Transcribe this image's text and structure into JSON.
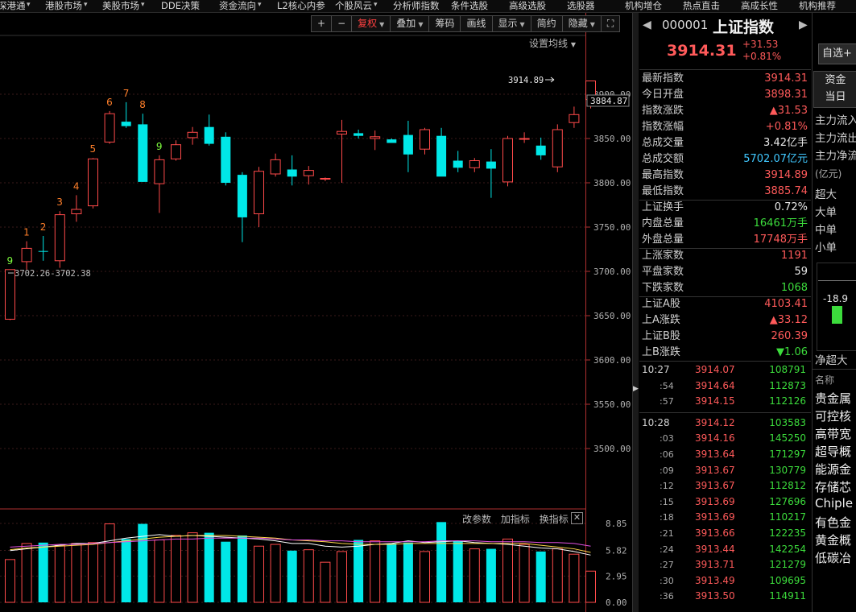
{
  "topbar": {
    "items": [
      {
        "label": "深港通",
        "arrow": true
      },
      {
        "label": "港股市场",
        "arrow": true
      },
      {
        "label": "美股市场",
        "arrow": true
      },
      {
        "label": "DDE决策",
        "arrow": false
      },
      {
        "label": "资金流向",
        "arrow": true
      },
      {
        "label": "L2核心内参",
        "arrow": false
      },
      {
        "label": "个股风云",
        "arrow": true
      },
      {
        "label": "分析师指数",
        "arrow": false
      },
      {
        "label": "条件选股",
        "arrow": false
      },
      {
        "label": "高级选股",
        "arrow": false
      },
      {
        "label": "选股器",
        "arrow": false
      },
      {
        "label": "机构增仓",
        "arrow": false
      },
      {
        "label": "热点直击",
        "arrow": false
      },
      {
        "label": "高成长性",
        "arrow": false
      },
      {
        "label": "机构推荐",
        "arrow": false
      }
    ]
  },
  "toolbar": {
    "plus": "+",
    "minus": "−",
    "fuquan": "复权",
    "overlay": "叠加",
    "chips": "筹码",
    "draw": "画线",
    "display": "显示",
    "simple": "简约",
    "hide": "隐藏",
    "fullscreen": "⛶"
  },
  "chart": {
    "ma_settings": "设置均线",
    "max_label": "3914.89",
    "last_price_tag": "3884.87",
    "range_label": "3702.26-3702.38",
    "y_ticks": [
      "3900.00",
      "3850.00",
      "3800.00",
      "3750.00",
      "3700.00",
      "3650.00",
      "3600.00",
      "3550.00",
      "3500.00"
    ],
    "vol_ticks": [
      "8.85",
      "5.82",
      "2.95",
      "0.00"
    ],
    "vol_links": {
      "params": "改参数",
      "add": "加指标",
      "switch": "换指标",
      "close": "✕"
    },
    "seq_colors": {
      "red": "#ff7f2a",
      "green": "#7fff3f"
    }
  },
  "chart_data": {
    "type": "candlestick",
    "ylim": [
      3460,
      3935
    ],
    "vol_ylim": [
      0,
      8.85
    ],
    "candles": [
      {
        "o": 3646,
        "h": 3702,
        "l": 3645,
        "c": 3702,
        "up": true,
        "vol": 4.8,
        "seq": "9",
        "seqc": "green"
      },
      {
        "o": 3711,
        "h": 3734,
        "l": 3702,
        "c": 3726,
        "up": true,
        "vol": 6.6,
        "seq": "1",
        "seqc": "red"
      },
      {
        "o": 3723,
        "h": 3740,
        "l": 3712,
        "c": 3723,
        "up": false,
        "vol": 6.7,
        "seq": "2",
        "seqc": "red"
      },
      {
        "o": 3712,
        "h": 3768,
        "l": 3704,
        "c": 3764,
        "up": true,
        "vol": 6.4,
        "seq": "3",
        "seqc": "red"
      },
      {
        "o": 3765,
        "h": 3786,
        "l": 3756,
        "c": 3770,
        "up": true,
        "vol": 6.6,
        "seq": "4",
        "seqc": "red"
      },
      {
        "o": 3774,
        "h": 3828,
        "l": 3771,
        "c": 3827,
        "up": true,
        "vol": 6.7,
        "seq": "5",
        "seqc": "red"
      },
      {
        "o": 3846,
        "h": 3881,
        "l": 3844,
        "c": 3878,
        "up": true,
        "vol": 8.8,
        "seq": "6",
        "seqc": "red"
      },
      {
        "o": 3864,
        "h": 3891,
        "l": 3862,
        "c": 3869,
        "up": false,
        "vol": 7.1,
        "seq": "7",
        "seqc": "red"
      },
      {
        "o": 3866,
        "h": 3878,
        "l": 3801,
        "c": 3801,
        "up": false,
        "vol": 8.8,
        "seq": "8",
        "seqc": "red"
      },
      {
        "o": 3799,
        "h": 3831,
        "l": 3766,
        "c": 3826,
        "up": true,
        "vol": 7.0,
        "seq": "9",
        "seqc": "green"
      },
      {
        "o": 3827,
        "h": 3848,
        "l": 3825,
        "c": 3843,
        "up": true,
        "vol": 7.5
      },
      {
        "o": 3851,
        "h": 3863,
        "l": 3843,
        "c": 3857,
        "up": true,
        "vol": 7.8
      },
      {
        "o": 3863,
        "h": 3877,
        "l": 3842,
        "c": 3844,
        "up": false,
        "vol": 7.8
      },
      {
        "o": 3852,
        "h": 3857,
        "l": 3797,
        "c": 3800,
        "up": false,
        "vol": 6.8
      },
      {
        "o": 3809,
        "h": 3812,
        "l": 3733,
        "c": 3761,
        "up": false,
        "vol": 7.5
      },
      {
        "o": 3765,
        "h": 3818,
        "l": 3750,
        "c": 3813,
        "up": true,
        "vol": 6.3
      },
      {
        "o": 3810,
        "h": 3833,
        "l": 3807,
        "c": 3826,
        "up": true,
        "vol": 6.5
      },
      {
        "o": 3815,
        "h": 3831,
        "l": 3797,
        "c": 3807,
        "up": false,
        "vol": 5.8
      },
      {
        "o": 3808,
        "h": 3819,
        "l": 3798,
        "c": 3814,
        "up": true,
        "vol": 5.9
      },
      {
        "o": 3805,
        "h": 3806,
        "l": 3802,
        "c": 3805,
        "up": true,
        "vol": 4.5
      },
      {
        "o": 3855,
        "h": 3871,
        "l": 3800,
        "c": 3858,
        "up": true,
        "vol": 5.7
      },
      {
        "o": 3853,
        "h": 3860,
        "l": 3850,
        "c": 3856,
        "up": false,
        "vol": 7.0
      },
      {
        "o": 3850,
        "h": 3859,
        "l": 3837,
        "c": 3852,
        "up": true,
        "vol": 6.9
      },
      {
        "o": 3849,
        "h": 3850,
        "l": 3845,
        "c": 3845,
        "up": false,
        "vol": 6.6
      },
      {
        "o": 3854,
        "h": 3870,
        "l": 3812,
        "c": 3832,
        "up": false,
        "vol": 6.7
      },
      {
        "o": 3838,
        "h": 3862,
        "l": 3832,
        "c": 3860,
        "up": true,
        "vol": 5.7
      },
      {
        "o": 3853,
        "h": 3862,
        "l": 3810,
        "c": 3807,
        "up": false,
        "vol": 9.0
      },
      {
        "o": 3825,
        "h": 3836,
        "l": 3812,
        "c": 3817,
        "up": false,
        "vol": 6.9
      },
      {
        "o": 3817,
        "h": 3828,
        "l": 3812,
        "c": 3825,
        "up": true,
        "vol": 6.0
      },
      {
        "o": 3824,
        "h": 3838,
        "l": 3783,
        "c": 3816,
        "up": false,
        "vol": 6.0
      },
      {
        "o": 3801,
        "h": 3853,
        "l": 3796,
        "c": 3850,
        "up": true,
        "vol": 7.1
      },
      {
        "o": 3850,
        "h": 3857,
        "l": 3845,
        "c": 3850,
        "up": true,
        "vol": 6.5
      },
      {
        "o": 3831,
        "h": 3851,
        "l": 3826,
        "c": 3842,
        "up": false,
        "vol": 5.7
      },
      {
        "o": 3818,
        "h": 3866,
        "l": 3812,
        "c": 3860,
        "up": true,
        "vol": 6.0
      },
      {
        "o": 3868,
        "h": 3886,
        "l": 3862,
        "c": 3877,
        "up": true,
        "vol": 5.4
      },
      {
        "o": 3894,
        "h": 3915,
        "l": 3884,
        "c": 3915,
        "up": true,
        "vol": 3.5
      }
    ],
    "ma_lines": [
      {
        "name": "MA5",
        "color": "#ffffff",
        "values": [
          5.8,
          6.0,
          6.2,
          6.4,
          6.6,
          6.6,
          6.9,
          7.2,
          7.4,
          7.6,
          7.4,
          7.5,
          7.4,
          7.3,
          7.2,
          7.1,
          6.9,
          6.6,
          6.6,
          6.3,
          6.2,
          6.3,
          6.5,
          6.6,
          6.9,
          6.7,
          6.8,
          6.9,
          6.7,
          6.6,
          6.5,
          6.3,
          6.1,
          6.0,
          5.7,
          5.3
        ]
      },
      {
        "name": "MA10",
        "color": "#ffd84a",
        "values": [
          5.9,
          6.1,
          6.2,
          6.3,
          6.4,
          6.5,
          6.7,
          6.9,
          7.1,
          7.3,
          7.4,
          7.5,
          7.5,
          7.5,
          7.4,
          7.3,
          7.2,
          7.0,
          6.9,
          6.8,
          6.6,
          6.5,
          6.5,
          6.5,
          6.6,
          6.6,
          6.6,
          6.6,
          6.6,
          6.6,
          6.6,
          6.6,
          6.4,
          6.2,
          6.0,
          5.6
        ]
      },
      {
        "name": "MA20",
        "color": "#e050e0",
        "values": [
          6.2,
          6.3,
          6.4,
          6.5,
          6.5,
          6.6,
          6.7,
          6.8,
          6.9,
          7.0,
          7.1,
          7.1,
          7.2,
          7.2,
          7.2,
          7.2,
          7.1,
          7.0,
          7.0,
          6.9,
          6.9,
          6.8,
          6.8,
          6.8,
          6.8,
          6.8,
          6.9,
          6.9,
          6.9,
          6.8,
          6.8,
          6.8,
          6.7,
          6.7,
          6.6,
          6.3
        ]
      }
    ]
  },
  "header": {
    "code": "000001",
    "name": "上证指数",
    "price": "3914.31",
    "change": "+31.53",
    "change_pct": "+0.81%"
  },
  "stats": [
    {
      "label": "最新指数",
      "value": "3914.31",
      "cls": "up"
    },
    {
      "label": "今日开盘",
      "value": "3898.31",
      "cls": "up"
    },
    {
      "label": "指数涨跌",
      "value": "▲31.53",
      "cls": "up"
    },
    {
      "label": "指数涨幅",
      "value": "+0.81%",
      "cls": "up"
    },
    {
      "label": "总成交量",
      "value": "3.42亿手",
      "cls": "wh"
    },
    {
      "label": "总成交额",
      "value": "5702.07亿元",
      "cls": "blu"
    },
    {
      "label": "最高指数",
      "value": "3914.89",
      "cls": "up"
    },
    {
      "label": "最低指数",
      "value": "3885.74",
      "cls": "up"
    },
    {
      "label": "上证换手",
      "value": "0.72%",
      "cls": "wh"
    },
    {
      "label": "内盘总量",
      "value": "16461万手",
      "cls": "dn"
    },
    {
      "label": "外盘总量",
      "value": "17748万手",
      "cls": "up"
    },
    {
      "label": "上涨家数",
      "value": "1191",
      "cls": "up"
    },
    {
      "label": "平盘家数",
      "value": "59",
      "cls": "wh"
    },
    {
      "label": "下跌家数",
      "value": "1068",
      "cls": "dn"
    },
    {
      "label": "上证A股",
      "value": "4103.41",
      "cls": "up"
    },
    {
      "label": "上A涨跌",
      "value": "▲33.12",
      "cls": "up"
    },
    {
      "label": "上证B股",
      "value": "260.39",
      "cls": "up"
    },
    {
      "label": "上B涨跌",
      "value": "▼1.06",
      "cls": "dn"
    }
  ],
  "ticks": [
    {
      "time": "10:27",
      "price": "3914.07",
      "vol": "108791",
      "major": true
    },
    {
      "time": ":54",
      "price": "3914.64",
      "vol": "112873",
      "major": false
    },
    {
      "time": ":57",
      "price": "3914.15",
      "vol": "112126",
      "major": false
    },
    {
      "time": "10:28",
      "price": "3914.12",
      "vol": "103583",
      "major": true
    },
    {
      "time": ":03",
      "price": "3914.16",
      "vol": "145250",
      "major": false
    },
    {
      "time": ":06",
      "price": "3913.64",
      "vol": "171297",
      "major": false
    },
    {
      "time": ":09",
      "price": "3913.67",
      "vol": "130779",
      "major": false
    },
    {
      "time": ":12",
      "price": "3913.67",
      "vol": "112812",
      "major": false
    },
    {
      "time": ":15",
      "price": "3913.69",
      "vol": "127696",
      "major": false
    },
    {
      "time": ":18",
      "price": "3913.69",
      "vol": "110217",
      "major": false
    },
    {
      "time": ":21",
      "price": "3913.66",
      "vol": "122235",
      "major": false
    },
    {
      "time": ":24",
      "price": "3913.44",
      "vol": "142254",
      "major": false
    },
    {
      "time": ":27",
      "price": "3913.71",
      "vol": "121279",
      "major": false
    },
    {
      "time": ":30",
      "price": "3913.49",
      "vol": "109695",
      "major": false
    },
    {
      "time": ":36",
      "price": "3913.50",
      "vol": "114911",
      "major": false
    }
  ],
  "right_strip": {
    "watch_btn": "自选+",
    "tab1": "资金",
    "tab2": "当日",
    "flows": [
      "主力流入",
      "主力流出",
      "主力净流"
    ],
    "unit": "(亿元)",
    "sizes": [
      "超大",
      "大单",
      "中单",
      "小单"
    ],
    "net_value": "-18.9",
    "net_label": "净超大",
    "name_header": "名称",
    "sectors": [
      "贵金属",
      "可控核",
      "高带宽",
      "超导概",
      "能源金",
      "存储芯",
      "Chiple",
      "有色金",
      "黄金概",
      "低碳冶"
    ]
  }
}
